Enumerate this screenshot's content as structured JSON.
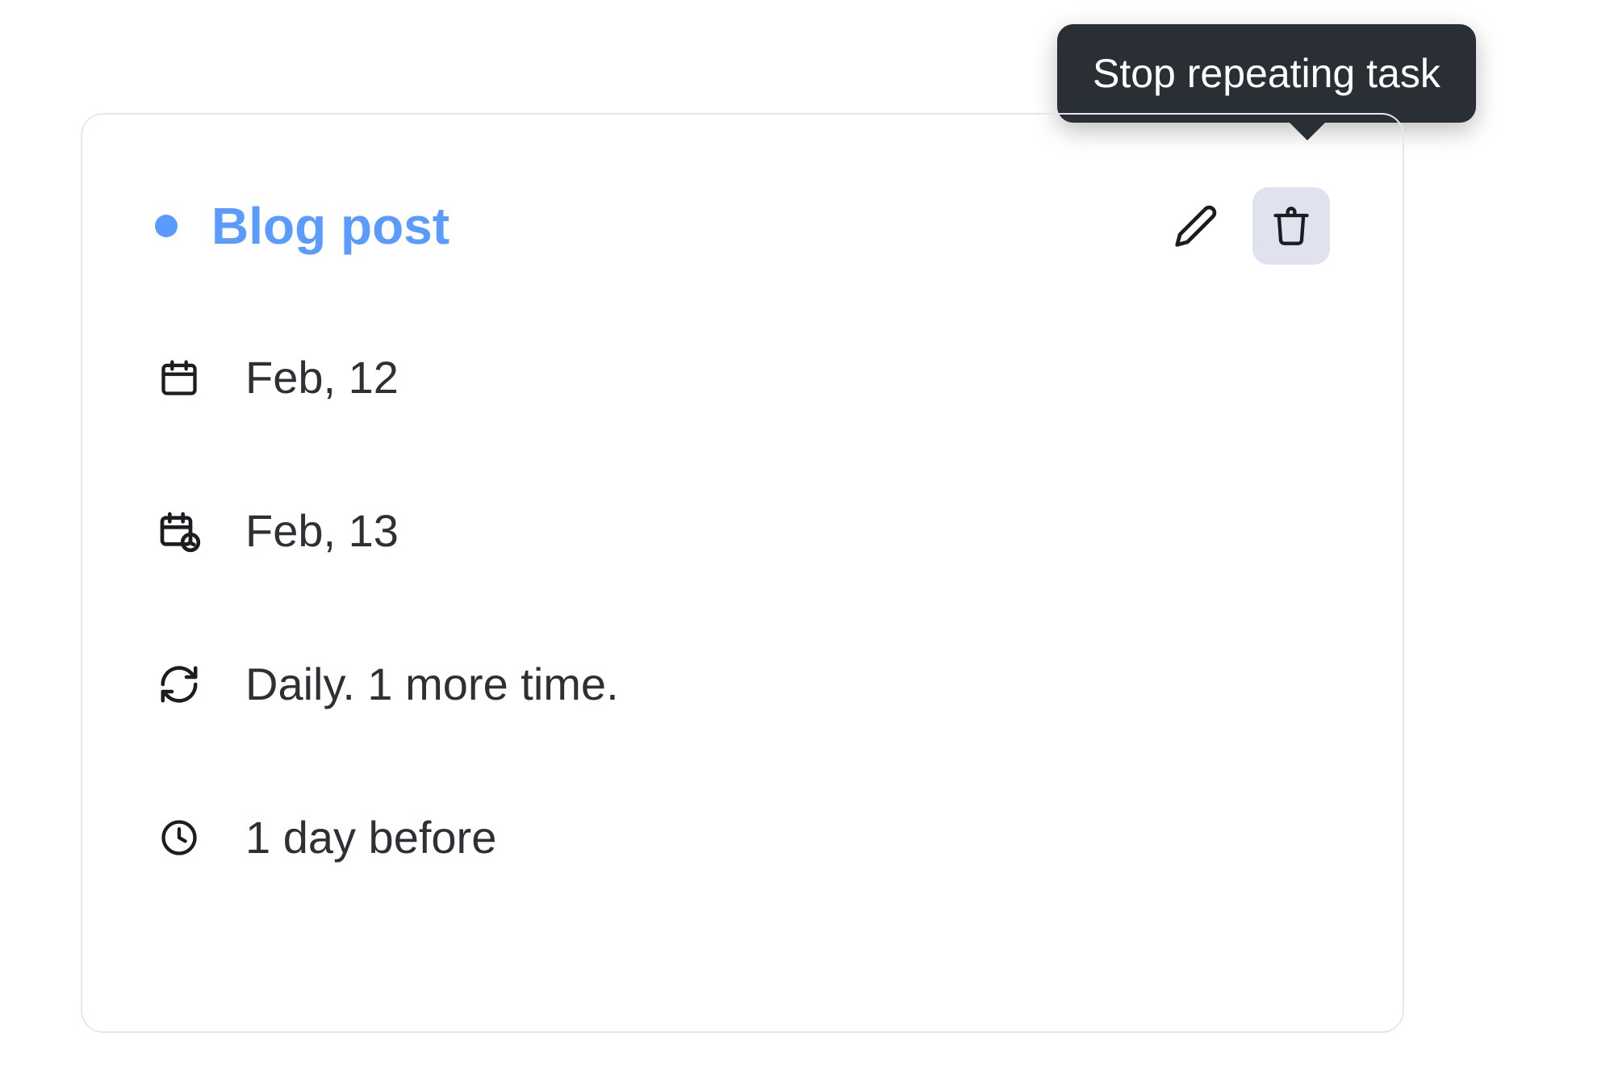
{
  "tooltip": {
    "text": "Stop repeating task"
  },
  "task": {
    "title": "Blog post",
    "status_dot_color": "#5a9bff"
  },
  "details": {
    "start_date": "Feb, 12",
    "due_date": "Feb, 13",
    "repeat": "Daily. 1 more time.",
    "reminder": "1 day before"
  },
  "icons": {
    "edit": "pencil-icon",
    "delete": "trash-icon",
    "calendar": "calendar-icon",
    "calendar_clock": "calendar-clock-icon",
    "repeat": "repeat-icon",
    "clock": "clock-icon"
  },
  "colors": {
    "accent": "#5a9bff",
    "tooltip_bg": "#2a2f36",
    "icon_btn_hover": "#e0e3ef",
    "border": "#e6e7eb",
    "text": "#2d3136"
  }
}
